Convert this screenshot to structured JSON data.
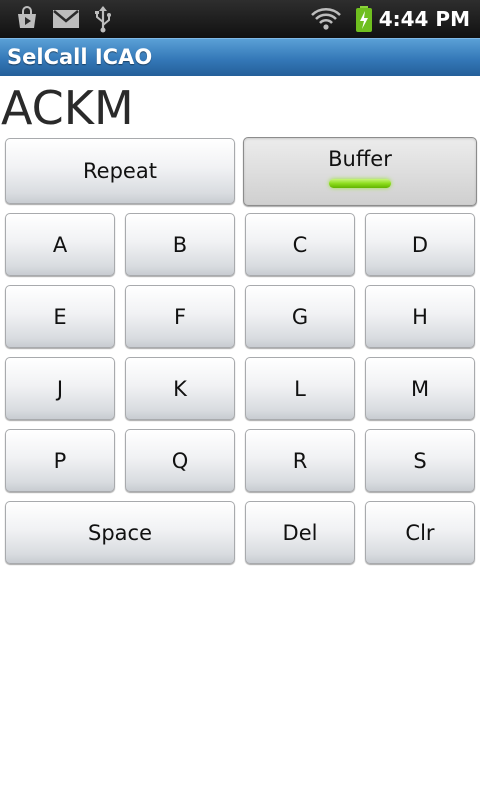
{
  "status_bar": {
    "icons": [
      "play-store-icon",
      "gmail-icon",
      "usb-icon",
      "wifi-icon",
      "battery-charging-icon"
    ],
    "time": "4:44 PM"
  },
  "app": {
    "title": "SelCall ICAO"
  },
  "display": {
    "value": "ACKM"
  },
  "controls": {
    "repeat_label": "Repeat",
    "buffer_label": "Buffer",
    "buffer_active": true,
    "indicator_color": "#8ddc1d"
  },
  "keypad": {
    "rows": [
      [
        "A",
        "B",
        "C",
        "D"
      ],
      [
        "E",
        "F",
        "G",
        "H"
      ],
      [
        "J",
        "K",
        "L",
        "M"
      ],
      [
        "P",
        "Q",
        "R",
        "S"
      ]
    ],
    "space_label": "Space",
    "del_label": "Del",
    "clr_label": "Clr"
  },
  "colors": {
    "title_bar": "#3478b8",
    "status_bar": "#1a1a1a"
  }
}
